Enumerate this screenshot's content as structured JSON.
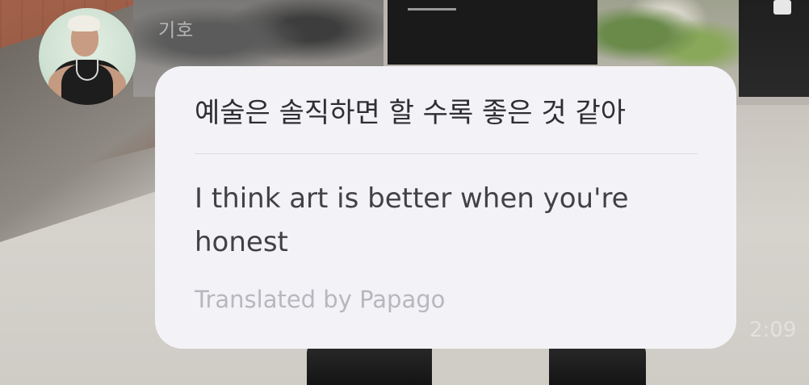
{
  "message": {
    "sender_name": "기호",
    "original_text": "예술은 솔직하면 할 수록 좋은 것 같아",
    "translated_text": "I think art is better when you're honest",
    "translation_credit": "Translated by Papago",
    "timestamp": "2:09"
  },
  "icons": {
    "avatar": "profile-photo"
  },
  "colors": {
    "bubble_background": "#f3f2f6",
    "primary_text": "#2f2f33",
    "credit_text": "#b8b7bd",
    "divider": "#dcdbe0"
  }
}
